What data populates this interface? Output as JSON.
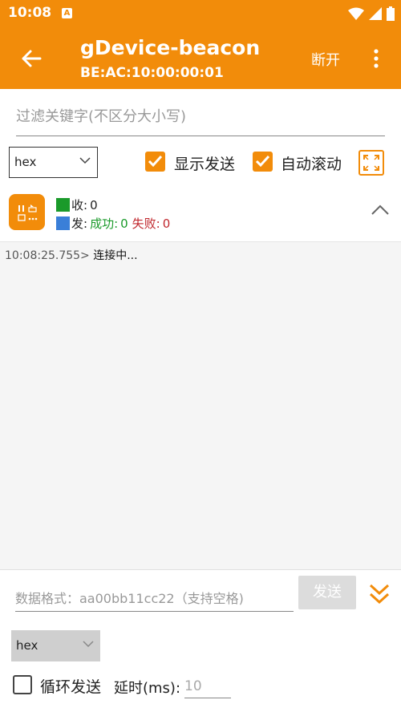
{
  "status_bar": {
    "time": "10:08",
    "notification_icon": "A"
  },
  "app_bar": {
    "title": "gDevice-beacon",
    "subtitle": "BE:AC:10:00:00:01",
    "disconnect_label": "断开"
  },
  "filter": {
    "placeholder": "过滤关键字(不区分大小写)"
  },
  "controls": {
    "format": "hex",
    "show_send_label": "显示发送",
    "show_send_checked": true,
    "auto_scroll_label": "自动滚动",
    "auto_scroll_checked": true
  },
  "stats": {
    "recv_label": "收:",
    "recv_count": "0",
    "send_label": "发:",
    "success_label": "成功:",
    "success_count": "0",
    "fail_label": "失败:",
    "fail_count": "0"
  },
  "log": [
    {
      "timestamp": "10:08:25.755>",
      "message": "连接中..."
    }
  ],
  "bottom": {
    "input_placeholder": "数据格式：aa00bb11cc22（支持空格)",
    "send_label": "发送",
    "format": "hex",
    "loop_label": "循环发送",
    "loop_checked": false,
    "delay_label": "延时(ms):",
    "delay_value": "10"
  },
  "colors": {
    "accent": "#f28c0a",
    "recv": "#1a9a2a",
    "send": "#3a7fd8",
    "fail": "#c0272d"
  }
}
